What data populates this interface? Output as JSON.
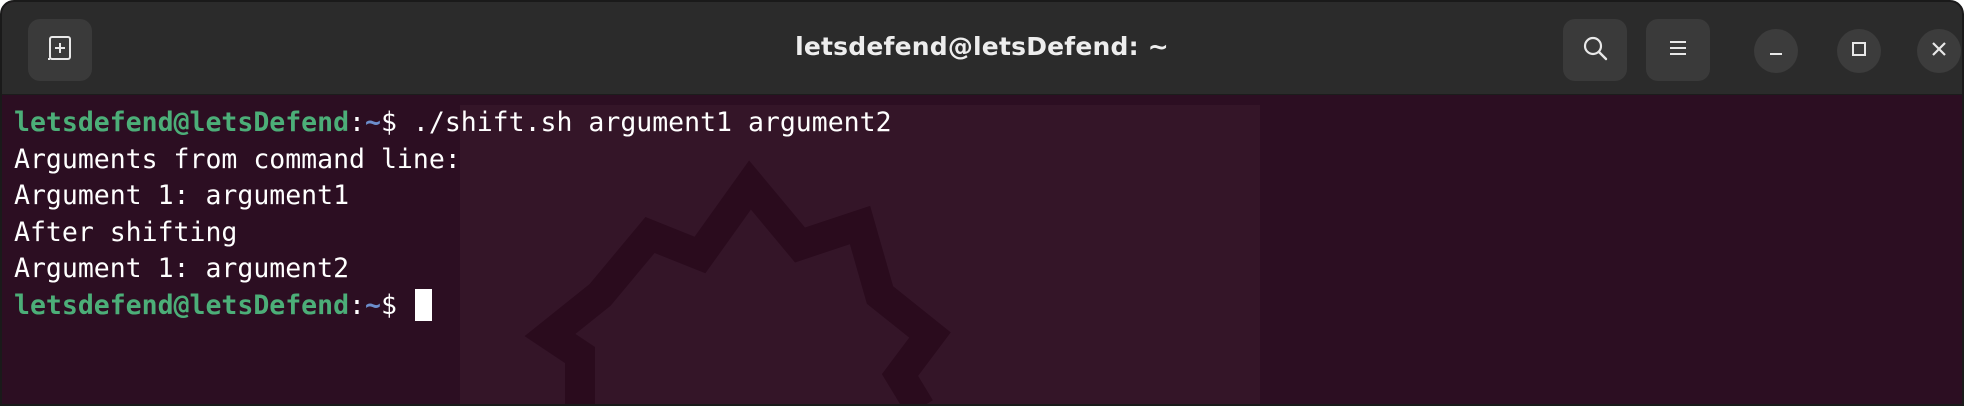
{
  "window": {
    "title": "letsdefend@letsDefend: ~"
  },
  "icons": {
    "new_tab": "new-tab-icon",
    "search": "search-icon",
    "menu": "hamburger-menu-icon",
    "minimize": "minimize-icon",
    "maximize": "maximize-icon",
    "close": "close-icon"
  },
  "terminal": {
    "prompt": {
      "user_host": "letsdefend@letsDefend",
      "colon": ":",
      "path": "~",
      "symbol": "$ "
    },
    "lines": [
      {
        "kind": "command",
        "command": "./shift.sh argument1 argument2"
      },
      {
        "kind": "output",
        "text": "Arguments from command line:"
      },
      {
        "kind": "output",
        "text": "Argument 1: argument1"
      },
      {
        "kind": "output",
        "text": "After shifting"
      },
      {
        "kind": "output",
        "text": "Argument 1: argument2"
      },
      {
        "kind": "prompt",
        "command": ""
      }
    ]
  },
  "colors": {
    "terminal_background": "#2c0e22",
    "titlebar_background": "#2b2b2b",
    "prompt_user_host": "#4cae78",
    "prompt_path": "#6c8ecc",
    "text": "#ffffff"
  }
}
